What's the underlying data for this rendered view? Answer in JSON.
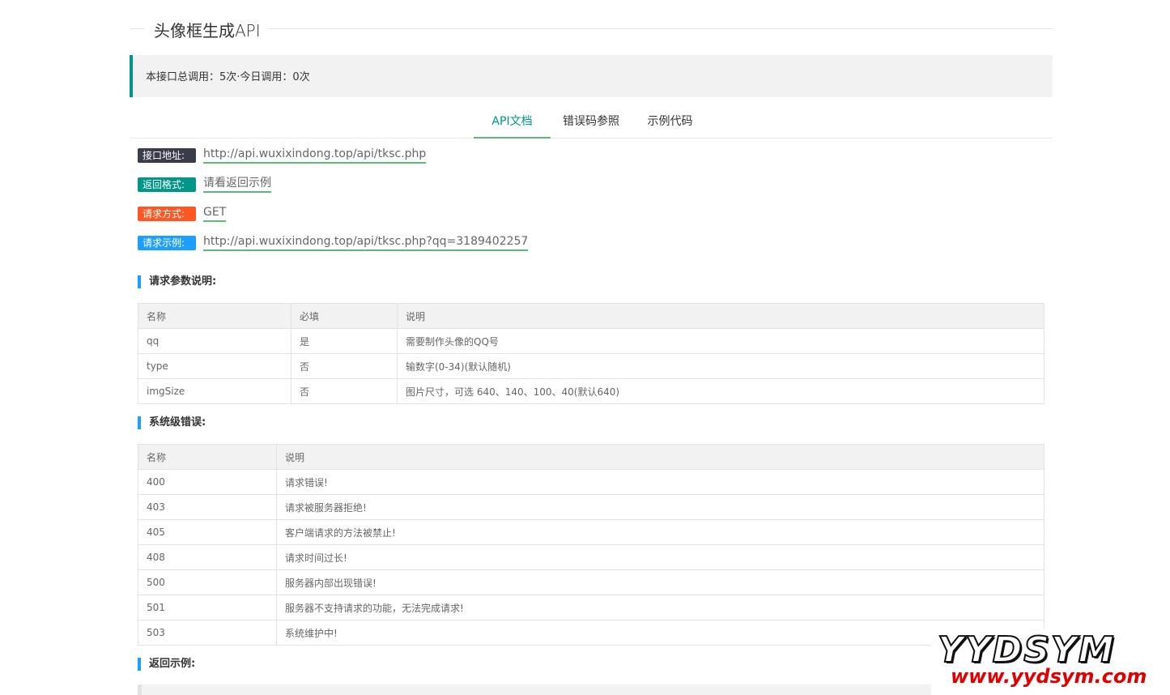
{
  "page": {
    "title": "头像框生成API",
    "stats": "本接口总调用：5次·今日调用：0次"
  },
  "tabs": [
    {
      "label": "API文档",
      "active": true
    },
    {
      "label": "错误码参照",
      "active": false
    },
    {
      "label": "示例代码",
      "active": false
    }
  ],
  "info": {
    "address": {
      "label": "接口地址:",
      "value": "http://api.wuxixindong.top/api/tksc.php"
    },
    "format": {
      "label": "返回格式:",
      "value": "请看返回示例"
    },
    "method": {
      "label": "请求方式:",
      "value": "GET"
    },
    "example": {
      "label": "请求示例:",
      "value": "http://api.wuxixindong.top/api/tksc.php?qq=3189402257"
    }
  },
  "params_section": {
    "heading": "请求参数说明:",
    "headers": [
      "名称",
      "必填",
      "说明"
    ],
    "rows": [
      [
        "qq",
        "是",
        "需要制作头像的QQ号"
      ],
      [
        "type",
        "否",
        "输数字(0-34)(默认随机)"
      ],
      [
        "imgSize",
        "否",
        "图片尺寸，可选 640、140、100、40(默认640)"
      ]
    ]
  },
  "errors_section": {
    "heading": "系统级错误:",
    "headers": [
      "名称",
      "说明"
    ],
    "rows": [
      [
        "400",
        "请求错误!"
      ],
      [
        "403",
        "请求被服务器拒绝!"
      ],
      [
        "405",
        "客户端请求的方法被禁止!"
      ],
      [
        "408",
        "请求时间过长!"
      ],
      [
        "500",
        "服务器内部出现错误!"
      ],
      [
        "501",
        "服务器不支持请求的功能，无法完成请求!"
      ],
      [
        "503",
        "系统维护中!"
      ]
    ]
  },
  "return_section": {
    "heading": "返回示例:"
  },
  "watermark": {
    "brand": "YYDSYM",
    "url": "www.yydsym.com"
  },
  "colors": {
    "accent": "#009688",
    "underline": "#5FB878",
    "badge_dark": "#393D49",
    "badge_orange": "#FF5722",
    "badge_blue": "#1E9FFF"
  }
}
